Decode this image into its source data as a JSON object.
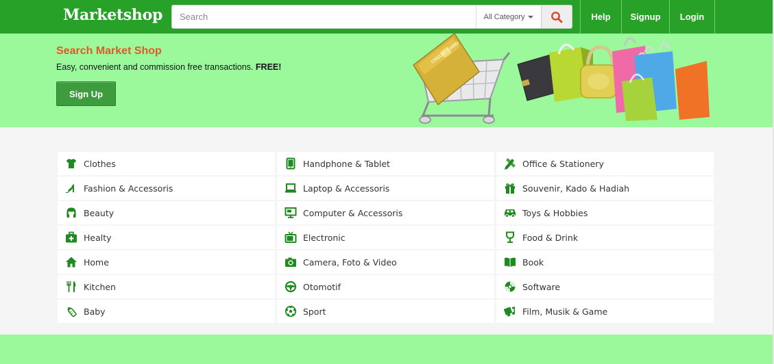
{
  "brand": {
    "name": "Marketshop"
  },
  "search": {
    "placeholder": "Search",
    "category": "All Category"
  },
  "nav": {
    "links": [
      "Help",
      "Signup",
      "Login"
    ]
  },
  "hero": {
    "title": "Search Market Shop",
    "subtitle": "Easy, convenient and commission free transactions.",
    "subtitle_bold": "FREE!",
    "signup_label": "Sign Up",
    "card_text": "CREDIT CARD"
  },
  "categories": {
    "col1": [
      {
        "label": "Clothes",
        "icon": "shirt-icon"
      },
      {
        "label": "Fashion & Accessoris",
        "icon": "high-heel-icon"
      },
      {
        "label": "Beauty",
        "icon": "hair-icon"
      },
      {
        "label": "Healty",
        "icon": "medkit-icon"
      },
      {
        "label": "Home",
        "icon": "home-icon"
      },
      {
        "label": "Kitchen",
        "icon": "cutlery-icon"
      },
      {
        "label": "Baby",
        "icon": "baby-bottle-icon"
      }
    ],
    "col2": [
      {
        "label": "Handphone & Tablet",
        "icon": "tablet-icon"
      },
      {
        "label": "Laptop & Accessoris",
        "icon": "laptop-icon"
      },
      {
        "label": "Computer & Accessoris",
        "icon": "monitor-icon"
      },
      {
        "label": "Electronic",
        "icon": "tv-icon"
      },
      {
        "label": "Camera, Foto & Video",
        "icon": "camera-icon"
      },
      {
        "label": "Otomotif",
        "icon": "steering-wheel-icon"
      },
      {
        "label": "Sport",
        "icon": "soccer-ball-icon"
      }
    ],
    "col3": [
      {
        "label": "Office & Stationery",
        "icon": "pencil-ruler-icon"
      },
      {
        "label": "Souvenir, Kado & Hadiah",
        "icon": "gift-icon"
      },
      {
        "label": "Toys & Hobbies",
        "icon": "toy-car-icon"
      },
      {
        "label": "Food & Drink",
        "icon": "glass-icon"
      },
      {
        "label": "Book",
        "icon": "book-icon"
      },
      {
        "label": "Software",
        "icon": "disc-icon"
      },
      {
        "label": "Film, Musik & Game",
        "icon": "music-film-icon"
      }
    ]
  },
  "colors": {
    "nav": "#28a128",
    "hero_bg": "#9bf99b",
    "accent_title": "#e2582b",
    "icon": "#1f8a1f"
  }
}
